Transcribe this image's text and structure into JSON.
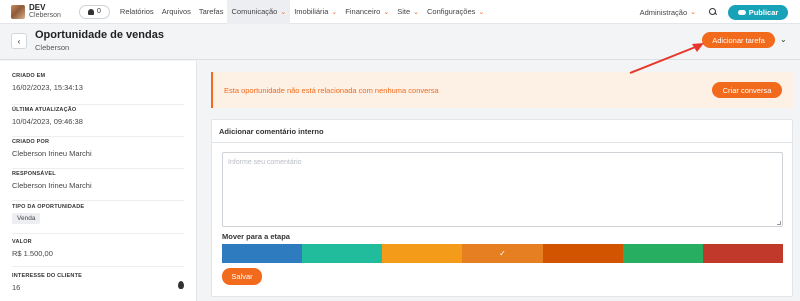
{
  "brand": {
    "name": "DEV",
    "user": "Cleberson"
  },
  "notifications": {
    "count": "0"
  },
  "menu": [
    {
      "label": "Relatórios",
      "has_chevron": false
    },
    {
      "label": "Arquivos",
      "has_chevron": false
    },
    {
      "label": "Tarefas",
      "has_chevron": false
    },
    {
      "label": "Comunicação",
      "has_chevron": true
    },
    {
      "label": "Imobiliária",
      "has_chevron": true
    },
    {
      "label": "Financeiro",
      "has_chevron": true
    },
    {
      "label": "Site",
      "has_chevron": true
    },
    {
      "label": "Configurações",
      "has_chevron": true
    }
  ],
  "nav_right": {
    "admin_label": "Administração",
    "publish_label": "Publicar"
  },
  "header": {
    "back_icon": "‹",
    "title": "Oportunidade de vendas",
    "subtitle": "Cleberson",
    "add_task_label": "Adicionar tarefa",
    "more_icon": "⌄"
  },
  "sidebar": {
    "created_label": "CRIADO EM",
    "created_value": "16/02/2023, 15:34:13",
    "updated_label": "ÚLTIMA ATUALIZAÇÃO",
    "updated_value": "10/04/2023, 09:46:38",
    "creator_label": "CRIADO POR",
    "creator_value": "Cleberson Irineu Marchi",
    "owner_label": "RESPONSÁVEL",
    "owner_value": "Cleberson Irineu Marchi",
    "type_label": "TIPO DA OPORTUNIDADE",
    "type_value": "Venda",
    "value_label": "VALOR",
    "value_value": "R$ 1.500,00",
    "interest_label": "INTERESSE DO CLIENTE",
    "interest_value": "16"
  },
  "alert": {
    "text": "Esta oportunidade não está relacionada com nenhuma conversa",
    "button_label": "Criar conversa"
  },
  "comment": {
    "title": "Adicionar comentário interno",
    "placeholder": "Informe seu comentário",
    "stage_label": "Mover para a etapa",
    "save_label": "Salvar"
  },
  "stages": [
    {
      "color": "#2f7bbf",
      "selected": false
    },
    {
      "color": "#21bc9c",
      "selected": false
    },
    {
      "color": "#f49c1a",
      "selected": false
    },
    {
      "color": "#e67e22",
      "selected": true
    },
    {
      "color": "#d35400",
      "selected": false
    },
    {
      "color": "#27ae60",
      "selected": false
    },
    {
      "color": "#c0392b",
      "selected": false
    }
  ],
  "colors": {
    "accent": "#f26a1b",
    "publish": "#17a2b8",
    "annotation_arrow": "#e8372a"
  },
  "check_icon": "✓",
  "chevron_icon": "⌄"
}
